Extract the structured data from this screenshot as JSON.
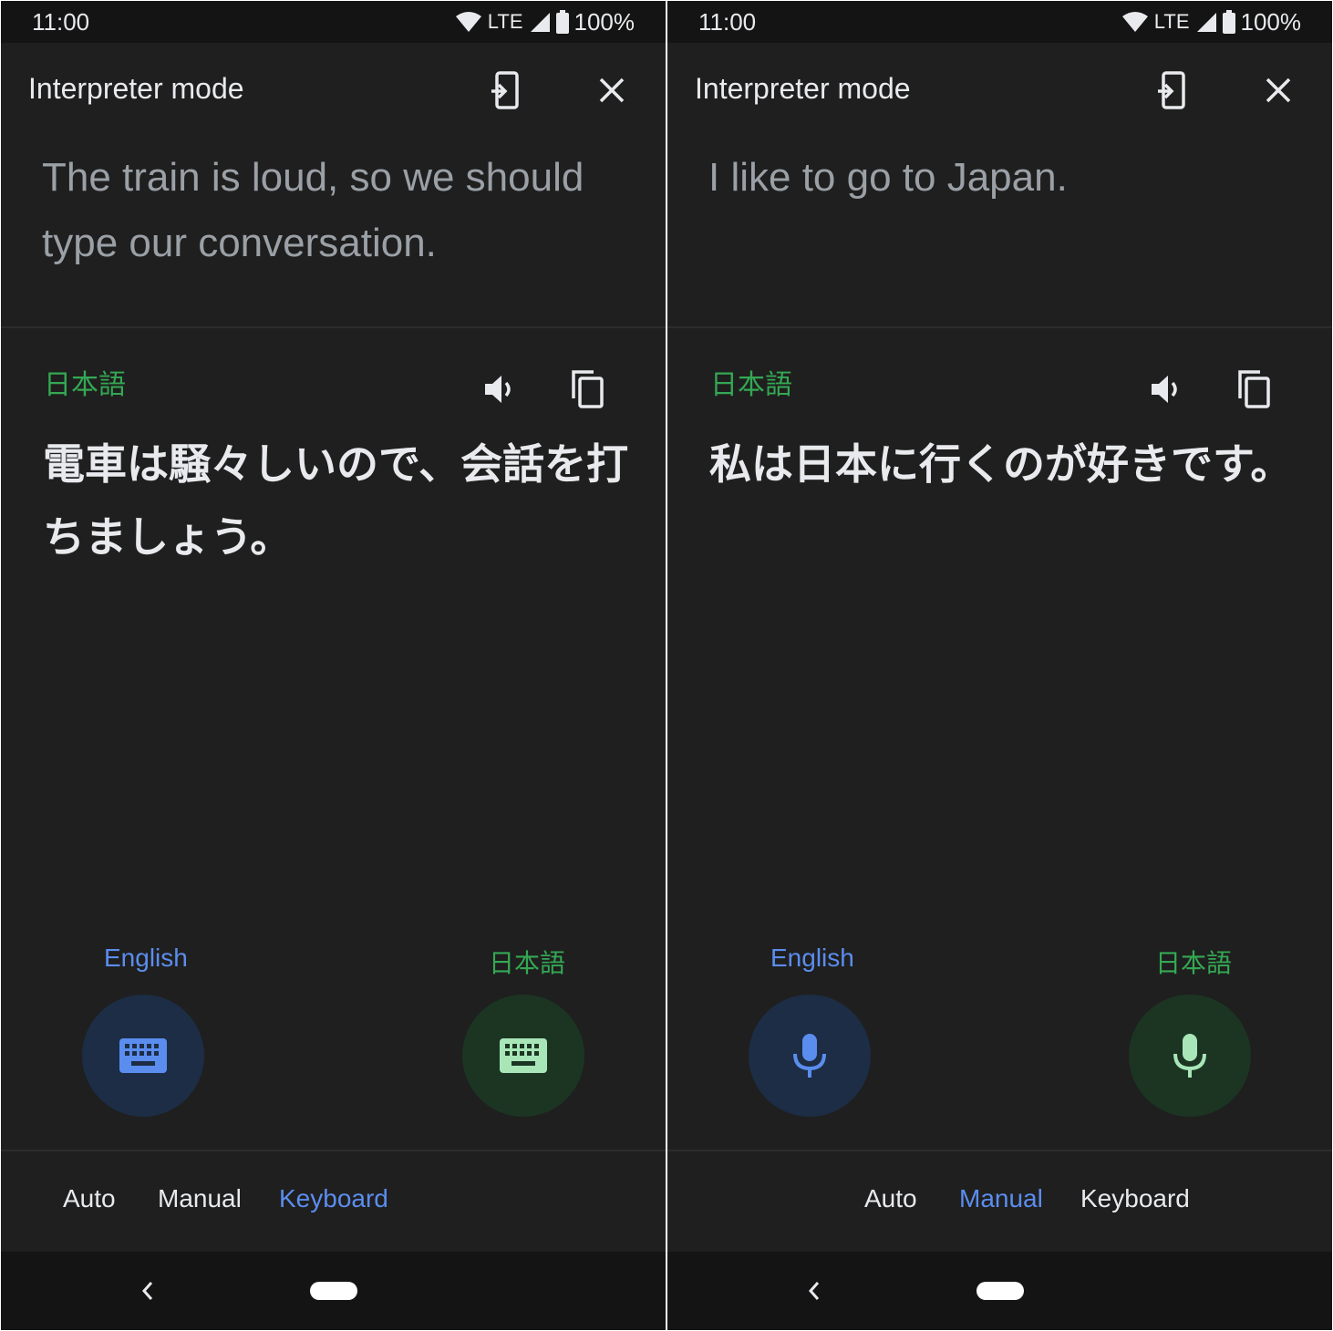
{
  "status": {
    "time": "11:00",
    "network": "LTE",
    "battery": "100%"
  },
  "header": {
    "title": "Interpreter mode"
  },
  "screens": [
    {
      "source_text": "The train is loud, so we should type our conversation.",
      "target_language": "日本語",
      "target_text": "電車は騒々しいので、会話を打ちましょう。",
      "buttons": {
        "left_label": "English",
        "right_label": "日本語",
        "icon": "keyboard-icon"
      },
      "modes": {
        "auto": "Auto",
        "manual": "Manual",
        "keyboard": "Keyboard",
        "active": "keyboard"
      }
    },
    {
      "source_text": "I like to go to Japan.",
      "target_language": "日本語",
      "target_text": "私は日本に行くのが好きです。",
      "buttons": {
        "left_label": "English",
        "right_label": "日本語",
        "icon": "microphone-icon"
      },
      "modes": {
        "auto": "Auto",
        "manual": "Manual",
        "keyboard": "Keyboard",
        "active": "manual"
      }
    }
  ],
  "colors": {
    "background": "#1f1f1f",
    "accent_blue": "#5b8def",
    "accent_green": "#34a853",
    "blue_circle": "#1c2d45",
    "green_circle": "#1c3523"
  }
}
